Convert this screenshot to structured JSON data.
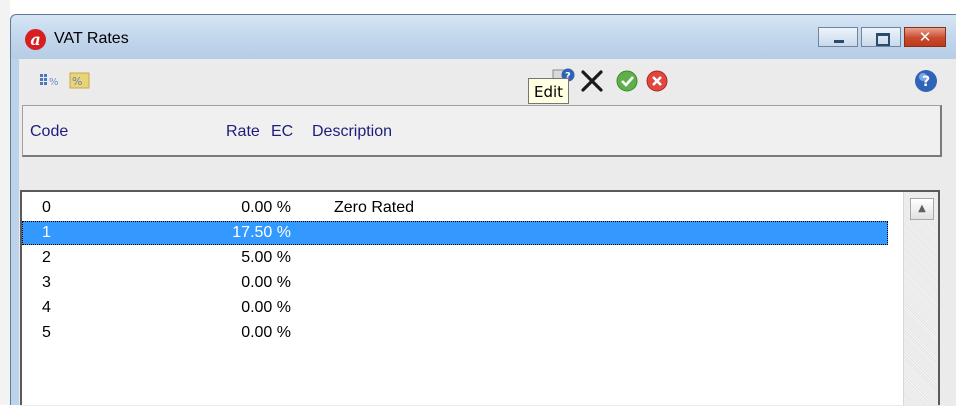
{
  "window": {
    "title": "VAT Rates",
    "app_icon_glyph": "a",
    "controls": {
      "minimize": "minimize-icon",
      "maximize": "maximize-icon",
      "close_glyph": "✕"
    }
  },
  "toolbar": {
    "tooltip": "Edit",
    "icons": [
      "vat-percent-icon",
      "vat-percent-alt-icon",
      "edit-icon",
      "delete-icon",
      "accept-icon",
      "cancel-icon",
      "help-icon"
    ]
  },
  "columns": {
    "code": "Code",
    "rate": "Rate",
    "ec": "EC",
    "description": "Description"
  },
  "rows": [
    {
      "code": "0",
      "rate": "0.00 %",
      "ec": "",
      "description": "Zero Rated",
      "selected": false
    },
    {
      "code": "1",
      "rate": "17.50 %",
      "ec": "",
      "description": "",
      "selected": true
    },
    {
      "code": "2",
      "rate": "5.00 %",
      "ec": "",
      "description": "",
      "selected": false
    },
    {
      "code": "3",
      "rate": "0.00 %",
      "ec": "",
      "description": "",
      "selected": false
    },
    {
      "code": "4",
      "rate": "0.00 %",
      "ec": "",
      "description": "",
      "selected": false
    },
    {
      "code": "5",
      "rate": "0.00 %",
      "ec": "",
      "description": "",
      "selected": false
    }
  ],
  "colors": {
    "selection": "#3399ff",
    "header_text": "#1d1d7a",
    "app_icon": "#d71e20"
  }
}
